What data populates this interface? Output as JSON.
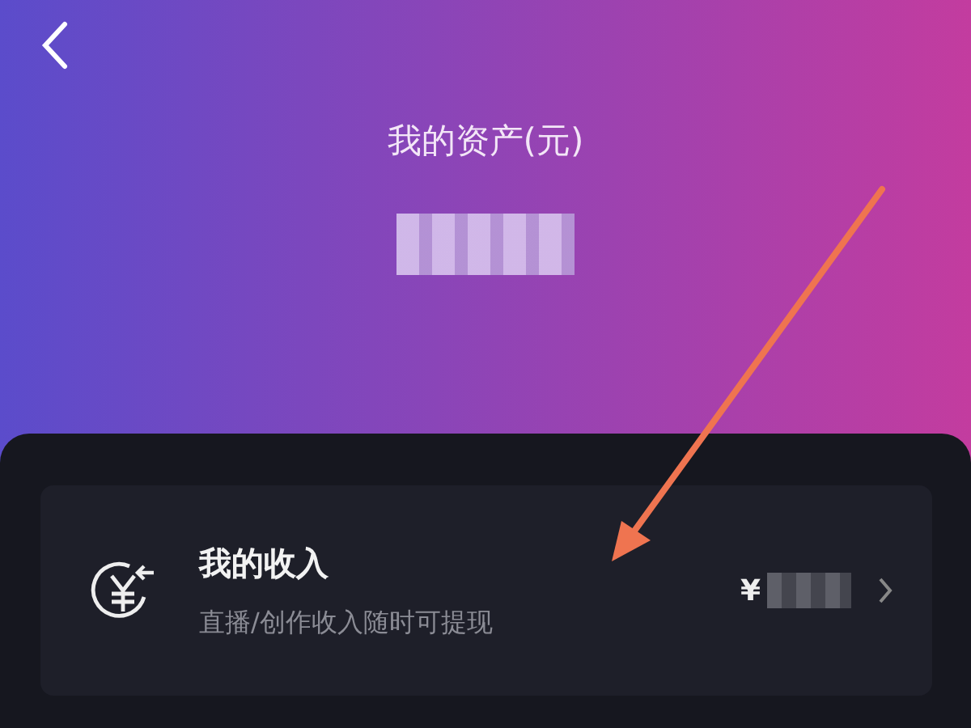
{
  "header": {
    "title": "我的资产(元)"
  },
  "income_card": {
    "title": "我的收入",
    "subtitle": "直播/创作收入随时可提现",
    "currency": "¥"
  }
}
